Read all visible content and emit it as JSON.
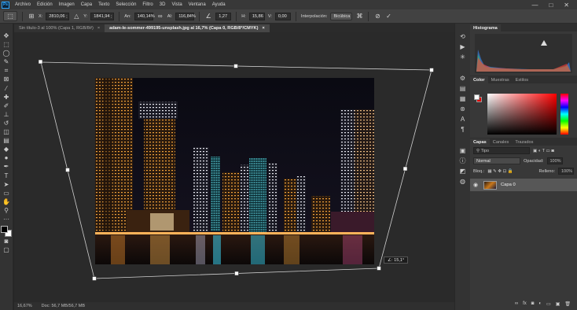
{
  "app": {
    "logo": "Ps"
  },
  "menu": [
    "Archivo",
    "Edición",
    "Imagen",
    "Capa",
    "Texto",
    "Selección",
    "Filtro",
    "3D",
    "Vista",
    "Ventana",
    "Ayuda"
  ],
  "window_controls": [
    "—",
    "□",
    "✕"
  ],
  "options": {
    "x_label": "X:",
    "x_value": "2810,06 ;",
    "y_label": "Y:",
    "y_value": "1841,94 ;",
    "w_label": "An:",
    "w_value": "140,14%",
    "h_label": "Al:",
    "h_value": "116,84%",
    "angle_value": "1,27",
    "hskew_label": "H:",
    "hskew_value": "15,86",
    "vskew_label": "V:",
    "vskew_value": "0,00",
    "interp_label": "Interpolación:",
    "interp_value": "Bicúbica"
  },
  "tabs": [
    {
      "label": "Sin título-3 al 100% (Capa 1, RGB/8#)",
      "close": "×"
    },
    {
      "label": "adam-le-sommer-499195-unsplash.jpg al 16,7% (Capa 0, RGB/8*/CMYK)",
      "close": "×"
    }
  ],
  "transform_tooltip": "∠: 15,1°",
  "status": {
    "zoom": "16,67%",
    "doc": "Doc: 56,7 MB/56,7 MB"
  },
  "panels": {
    "histogram_tab": "Histograma",
    "color_tabs": [
      "Color",
      "Muestras",
      "Estilos"
    ],
    "layers_tabs": [
      "Capas",
      "Canales",
      "Trazados"
    ],
    "search_placeholder": "Tipo",
    "blend_mode": "Normal",
    "opacity_label": "Opacidad:",
    "opacity_value": "100%",
    "lock_label": "Bloq.:",
    "fill_label": "Relleno:",
    "fill_value": "100%",
    "layer_name": "Capa 0",
    "footer_icons": [
      "∞",
      "fx",
      "◙",
      "◐",
      "▭",
      "▣",
      "🗑"
    ]
  },
  "colors": {
    "accent": "#31a8ff",
    "bg_swatch": "#e00000"
  }
}
